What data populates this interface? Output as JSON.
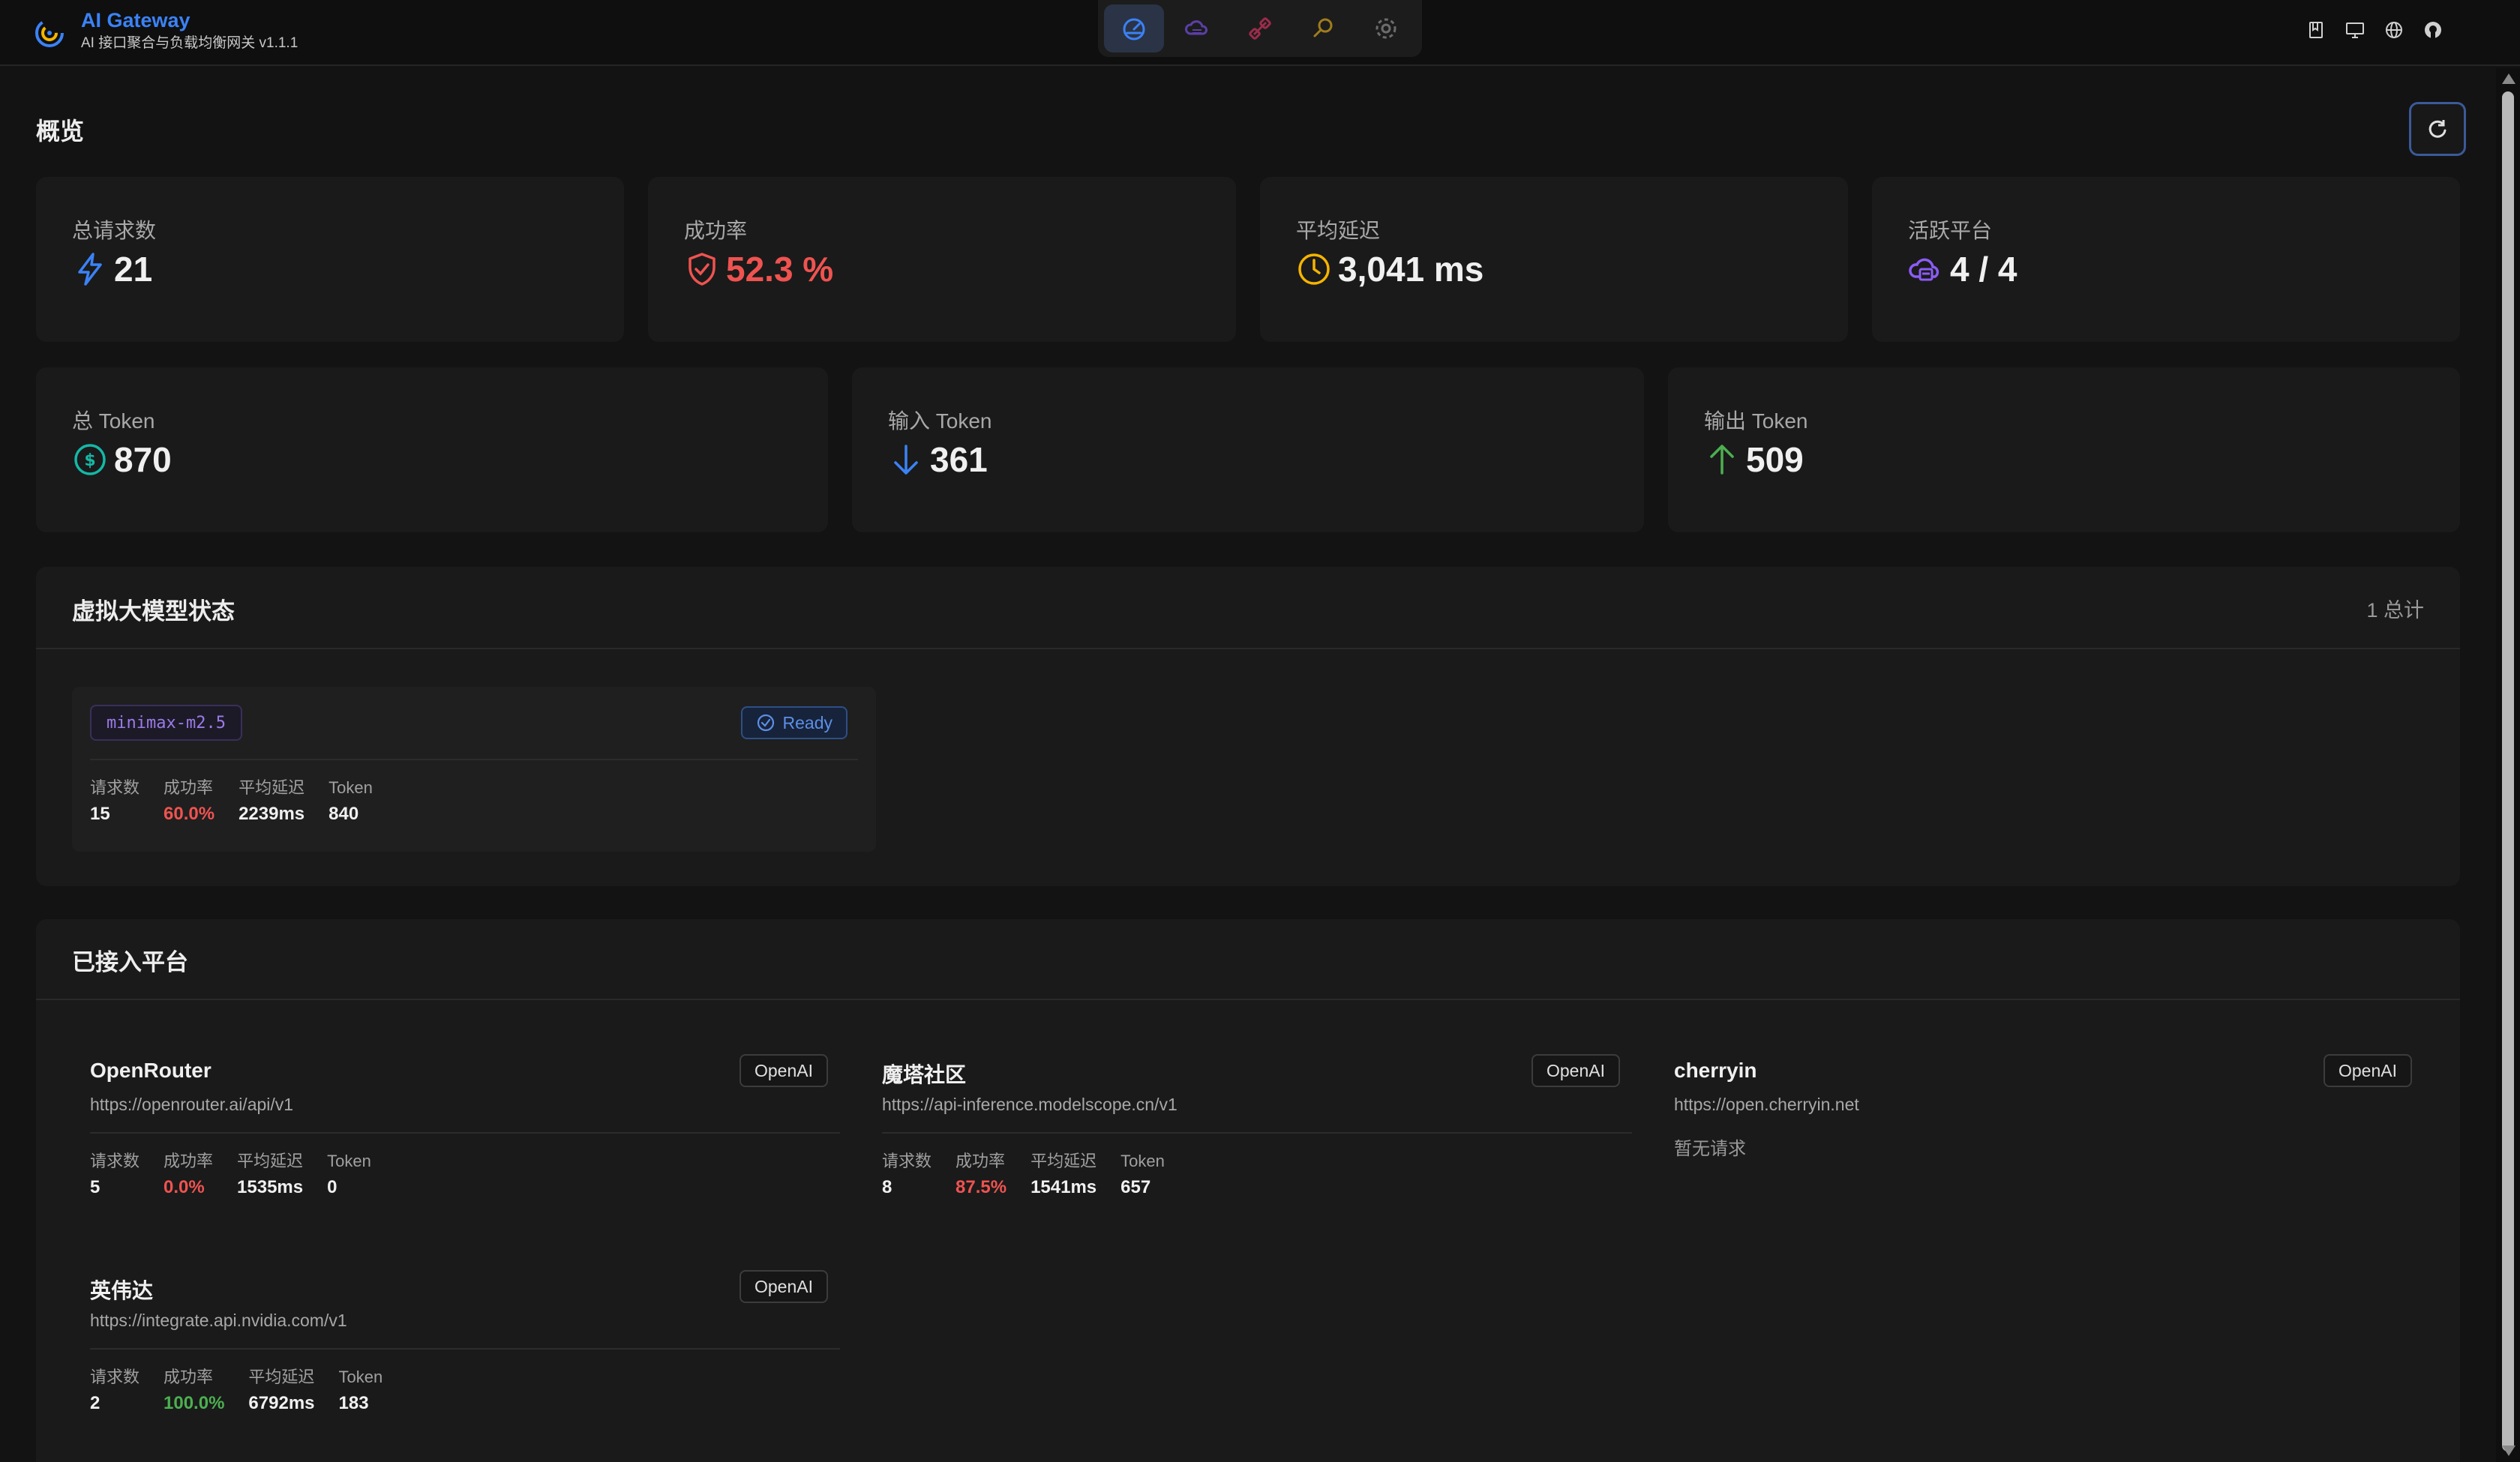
{
  "app": {
    "title": "AI Gateway",
    "subtitle": "AI 接口聚合与负载均衡网关 v1.1.1"
  },
  "nav": {
    "items": [
      {
        "icon": "dashboard-icon",
        "active": true
      },
      {
        "icon": "cloud-icon",
        "active": false
      },
      {
        "icon": "plug-icon",
        "active": false
      },
      {
        "icon": "search-icon",
        "active": false
      },
      {
        "icon": "gear-icon",
        "active": false
      }
    ]
  },
  "toolbar": {
    "icons": [
      "book-icon",
      "monitor-icon",
      "globe-icon",
      "github-icon"
    ]
  },
  "overview": {
    "title": "概览",
    "stats": [
      {
        "label": "总请求数",
        "value": "21",
        "icon": "bolt-icon",
        "color": "#3b82f6",
        "value_color": "#f0f0f0"
      },
      {
        "label": "成功率",
        "value": "52.3 %",
        "icon": "shield-check-icon",
        "color": "#ef5350",
        "value_color": "#ef5350"
      },
      {
        "label": "平均延迟",
        "value": "3,041 ms",
        "icon": "clock-icon",
        "color": "#f5b400",
        "value_color": "#f0f0f0"
      },
      {
        "label": "活跃平台",
        "value": "4 / 4",
        "icon": "cloud-server-icon",
        "color": "#8b5cf6",
        "value_color": "#f0f0f0"
      }
    ],
    "tokens": [
      {
        "label": "总 Token",
        "value": "870",
        "icon": "dollar-icon",
        "color": "#14b8a6"
      },
      {
        "label": "输入 Token",
        "value": "361",
        "icon": "arrow-down-icon",
        "color": "#3b82f6"
      },
      {
        "label": "输出 Token",
        "value": "509",
        "icon": "arrow-up-icon",
        "color": "#4caf50"
      }
    ]
  },
  "virtual_models": {
    "title": "虚拟大模型状态",
    "count": "1 总计",
    "items": [
      {
        "name": "minimax-m2.5",
        "status": "Ready",
        "metrics": [
          {
            "label": "请求数",
            "value": "15",
            "tone": ""
          },
          {
            "label": "成功率",
            "value": "60.0%",
            "tone": "red"
          },
          {
            "label": "平均延迟",
            "value": "2239ms",
            "tone": ""
          },
          {
            "label": "Token",
            "value": "840",
            "tone": ""
          }
        ]
      }
    ]
  },
  "platforms": {
    "title": "已接入平台",
    "items": [
      {
        "name": "OpenRouter",
        "badge": "OpenAI",
        "url": "https://openrouter.ai/api/v1",
        "metrics": [
          {
            "label": "请求数",
            "value": "5",
            "tone": ""
          },
          {
            "label": "成功率",
            "value": "0.0%",
            "tone": "red"
          },
          {
            "label": "平均延迟",
            "value": "1535ms",
            "tone": ""
          },
          {
            "label": "Token",
            "value": "0",
            "tone": ""
          }
        ]
      },
      {
        "name": "魔塔社区",
        "badge": "OpenAI",
        "url": "https://api-inference.modelscope.cn/v1",
        "metrics": [
          {
            "label": "请求数",
            "value": "8",
            "tone": ""
          },
          {
            "label": "成功率",
            "value": "87.5%",
            "tone": "red"
          },
          {
            "label": "平均延迟",
            "value": "1541ms",
            "tone": ""
          },
          {
            "label": "Token",
            "value": "657",
            "tone": ""
          }
        ]
      },
      {
        "name": "cherryin",
        "badge": "OpenAI",
        "url": "https://open.cherryin.net",
        "empty": "暂无请求"
      },
      {
        "name": "英伟达",
        "badge": "OpenAI",
        "url": "https://integrate.api.nvidia.com/v1",
        "metrics": [
          {
            "label": "请求数",
            "value": "2",
            "tone": ""
          },
          {
            "label": "成功率",
            "value": "100.0%",
            "tone": "green"
          },
          {
            "label": "平均延迟",
            "value": "6792ms",
            "tone": ""
          },
          {
            "label": "Token",
            "value": "183",
            "tone": ""
          }
        ]
      }
    ]
  }
}
